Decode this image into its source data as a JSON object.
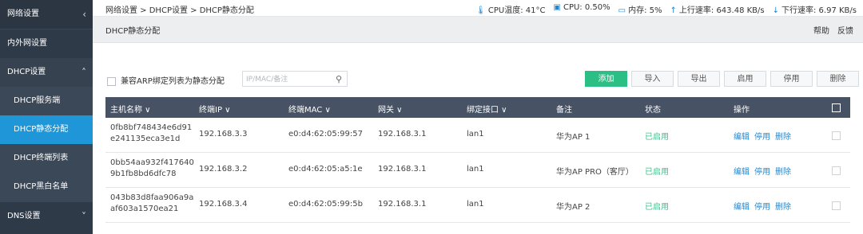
{
  "sidebar": {
    "top_label": "网络设置",
    "items": [
      {
        "label": "内外网设置"
      },
      {
        "label": "DHCP设置"
      }
    ],
    "sub_items": [
      {
        "label": "DHCP服务端"
      },
      {
        "label": "DHCP静态分配"
      },
      {
        "label": "DHCP终端列表"
      },
      {
        "label": "DHCP黑白名单"
      }
    ],
    "bottom_label": "DNS设置"
  },
  "topbar": {
    "breadcrumb": "网络设置 > DHCP设置 > DHCP静态分配",
    "cpu_temp": "CPU温度: 41°C",
    "cpu": "CPU: 0.50%",
    "mem": "内存: 5%",
    "up": "上行速率: 643.48 KB/s",
    "down": "下行速率: 6.97 KB/s"
  },
  "titlebar": {
    "title": "DHCP静态分配",
    "help": "帮助",
    "feedback": "反馈"
  },
  "toolbar": {
    "compat_label": "兼容ARP绑定列表为静态分配",
    "search_placeholder": "IP/MAC/备注",
    "add": "添加",
    "import": "导入",
    "export": "导出",
    "enable": "启用",
    "disable": "停用",
    "delete": "删除"
  },
  "table": {
    "headers": [
      "主机名称 ∨",
      "终端IP ∨",
      "终端MAC ∨",
      "网关 ∨",
      "绑定接口 ∨",
      "备注",
      "状态",
      "操作"
    ],
    "rows": [
      {
        "host": "0fb8bf748434e6d91e241135eca3e1d",
        "ip": "192.168.3.3",
        "mac": "e0:d4:62:05:99:57",
        "gw": "192.168.3.1",
        "iface": "lan1",
        "note": "华为AP 1",
        "status": "已启用"
      },
      {
        "host": "0bb54aa932f4176409b1fb8bd6dfc78",
        "ip": "192.168.3.2",
        "mac": "e0:d4:62:05:a5:1e",
        "gw": "192.168.3.1",
        "iface": "lan1",
        "note": "华为AP PRO（客厅）",
        "status": "已启用"
      },
      {
        "host": "043b83d8faa906a9aaf603a1570ea21",
        "ip": "192.168.3.4",
        "mac": "e0:d4:62:05:99:5b",
        "gw": "192.168.3.1",
        "iface": "lan1",
        "note": "华为AP 2",
        "status": "已启用"
      }
    ],
    "actions": {
      "edit": "编辑",
      "stop": "停用",
      "del": "删除"
    }
  }
}
